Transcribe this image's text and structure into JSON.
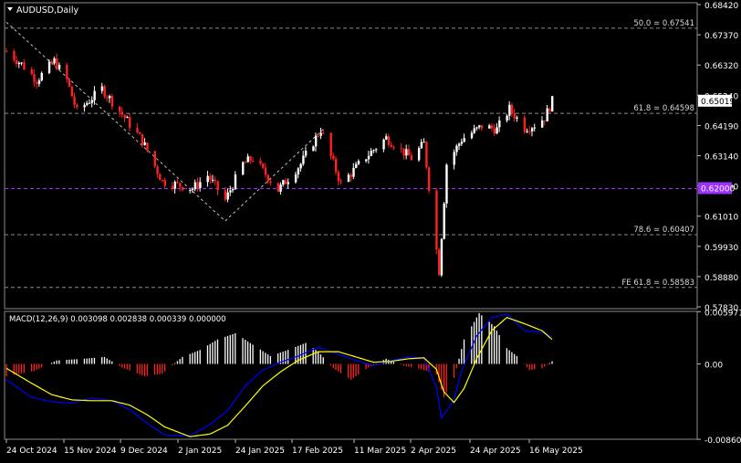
{
  "symbol_label": "AUDUSD,Daily",
  "macd_label": "MACD(12,26,9) 0.003098 0.002838 0.000339 0.000000",
  "colors": {
    "background": "#000000",
    "bull_candle": "#ffffff",
    "bear_candle": "#ff2020",
    "grid_dash": "#8a8a8a",
    "support_line": "#9b30ff",
    "price_tag_bg": "#ffffff",
    "support_tag_bg": "#9b30ff",
    "macd_line": "#0000ff",
    "signal_line": "#ffff00",
    "trendline": "#c0c0c0"
  },
  "chart_data": [
    {
      "type": "candlestick",
      "panel": "price",
      "title": "AUDUSD,Daily",
      "ylim": [
        0.5785,
        0.6842
      ],
      "y_ticks": [
        "0.68420",
        "0.67370",
        "0.66320",
        "0.65240",
        "0.64190",
        "0.63140",
        "0.62090",
        "0.61010",
        "0.59930",
        "0.58880",
        "0.57830"
      ],
      "x_ticks": [
        "24 Oct 2024",
        "15 Nov 2024",
        "9 Dec 2024",
        "2 Jan 2025",
        "24 Jan 2025",
        "17 Feb 2025",
        "11 Mar 2025",
        "2 Apr 2025",
        "24 Apr 2025",
        "16 May 2025"
      ],
      "current_price": "0.65019",
      "support_tag": "0.62000",
      "levels": [
        {
          "label": "50.0 = 0.67541",
          "value": 0.67541,
          "style": "dashed"
        },
        {
          "label": "61.8 = 0.64598",
          "value": 0.64598,
          "style": "dashed"
        },
        {
          "label": "",
          "value": 0.62,
          "style": "support"
        },
        {
          "label": "78.6 = 0.60407",
          "value": 0.60407,
          "style": "dashed"
        },
        {
          "label": "FE 61.8 = 0.58583",
          "value": 0.58583,
          "style": "dashed"
        }
      ],
      "trendlines": [
        {
          "from": {
            "date": "2024-10-18",
            "price": 0.6775
          },
          "to": {
            "date": "2025-01-13",
            "price": 0.6088
          }
        },
        {
          "from": {
            "date": "2025-01-13",
            "price": 0.6088
          },
          "to": {
            "date": "2025-02-21",
            "price": 0.6405
          }
        }
      ],
      "segments": [
        {
          "date": "2024-10-18",
          "price": 0.6675
        },
        {
          "date": "2024-10-24",
          "price": 0.663
        },
        {
          "date": "2024-10-30",
          "price": 0.6575
        },
        {
          "date": "2024-11-06",
          "price": 0.664
        },
        {
          "date": "2024-11-11",
          "price": 0.6575
        },
        {
          "date": "2024-11-15",
          "price": 0.6465
        },
        {
          "date": "2024-11-25",
          "price": 0.6545
        },
        {
          "date": "2024-12-04",
          "price": 0.6445
        },
        {
          "date": "2024-12-11",
          "price": 0.6365
        },
        {
          "date": "2024-12-19",
          "price": 0.6225
        },
        {
          "date": "2024-12-31",
          "price": 0.62
        },
        {
          "date": "2025-01-06",
          "price": 0.6245
        },
        {
          "date": "2025-01-13",
          "price": 0.616
        },
        {
          "date": "2025-01-20",
          "price": 0.6285
        },
        {
          "date": "2025-01-24",
          "price": 0.6305
        },
        {
          "date": "2025-02-03",
          "price": 0.6195
        },
        {
          "date": "2025-02-12",
          "price": 0.6285
        },
        {
          "date": "2025-02-20",
          "price": 0.6405
        },
        {
          "date": "2025-02-28",
          "price": 0.6215
        },
        {
          "date": "2025-03-10",
          "price": 0.631
        },
        {
          "date": "2025-03-18",
          "price": 0.6375
        },
        {
          "date": "2025-03-28",
          "price": 0.6305
        },
        {
          "date": "2025-04-02",
          "price": 0.6355
        },
        {
          "date": "2025-04-08",
          "price": 0.5915
        },
        {
          "date": "2025-04-11",
          "price": 0.6285
        },
        {
          "date": "2025-04-17",
          "price": 0.637
        },
        {
          "date": "2025-04-25",
          "price": 0.6415
        },
        {
          "date": "2025-05-01",
          "price": 0.6405
        },
        {
          "date": "2025-05-06",
          "price": 0.6475
        },
        {
          "date": "2025-05-12",
          "price": 0.641
        },
        {
          "date": "2025-05-16",
          "price": 0.642
        },
        {
          "date": "2025-05-20",
          "price": 0.6445
        },
        {
          "date": "2025-05-23",
          "price": 0.6502
        }
      ]
    },
    {
      "type": "macd",
      "panel": "indicator",
      "title": "MACD(12,26,9) 0.003098 0.002838 0.000339 0.000000",
      "ylim": [
        -0.0086,
        0.006
      ],
      "y_ticks": [
        "0.005971",
        "0.00",
        "-0.008607"
      ],
      "histogram": [
        {
          "date": "2024-10-18",
          "value": -0.0014
        },
        {
          "date": "2024-10-29",
          "value": -0.0008
        },
        {
          "date": "2024-11-07",
          "value": 0.0004
        },
        {
          "date": "2024-11-18",
          "value": 0.0006
        },
        {
          "date": "2024-11-26",
          "value": 0.0008
        },
        {
          "date": "2024-12-03",
          "value": -0.0004
        },
        {
          "date": "2024-12-12",
          "value": -0.0014
        },
        {
          "date": "2024-12-19",
          "value": -0.0011
        },
        {
          "date": "2024-12-27",
          "value": 0.0008
        },
        {
          "date": "2025-01-03",
          "value": 0.0016
        },
        {
          "date": "2025-01-10",
          "value": 0.0028
        },
        {
          "date": "2025-01-17",
          "value": 0.0035
        },
        {
          "date": "2025-01-24",
          "value": 0.0022
        },
        {
          "date": "2025-01-31",
          "value": 0.0009
        },
        {
          "date": "2025-02-07",
          "value": 0.0016
        },
        {
          "date": "2025-02-14",
          "value": 0.0024
        },
        {
          "date": "2025-02-19",
          "value": 0.0014
        },
        {
          "date": "2025-02-25",
          "value": -0.0005
        },
        {
          "date": "2025-03-04",
          "value": -0.0018
        },
        {
          "date": "2025-03-11",
          "value": -0.0004
        },
        {
          "date": "2025-03-18",
          "value": 0.0006
        },
        {
          "date": "2025-03-25",
          "value": -0.0002
        },
        {
          "date": "2025-04-01",
          "value": -0.0006
        },
        {
          "date": "2025-04-07",
          "value": -0.0012
        },
        {
          "date": "2025-04-10",
          "value": -0.0038
        },
        {
          "date": "2025-04-14",
          "value": -0.0016
        },
        {
          "date": "2025-04-18",
          "value": 0.0028
        },
        {
          "date": "2025-04-24",
          "value": 0.0058
        },
        {
          "date": "2025-04-30",
          "value": 0.0043
        },
        {
          "date": "2025-05-05",
          "value": 0.0018
        },
        {
          "date": "2025-05-09",
          "value": 0.0009
        },
        {
          "date": "2025-05-14",
          "value": -0.0007
        },
        {
          "date": "2025-05-19",
          "value": -0.0005
        },
        {
          "date": "2025-05-23",
          "value": 0.0003
        }
      ],
      "macd": [
        {
          "date": "2024-10-18",
          "value": -0.0018
        },
        {
          "date": "2024-10-28",
          "value": -0.0038
        },
        {
          "date": "2024-11-05",
          "value": -0.0043
        },
        {
          "date": "2024-11-13",
          "value": -0.0045
        },
        {
          "date": "2024-11-21",
          "value": -0.0039
        },
        {
          "date": "2024-11-29",
          "value": -0.0042
        },
        {
          "date": "2024-12-06",
          "value": -0.0052
        },
        {
          "date": "2024-12-13",
          "value": -0.0068
        },
        {
          "date": "2024-12-20",
          "value": -0.0081
        },
        {
          "date": "2024-12-30",
          "value": -0.0082
        },
        {
          "date": "2025-01-07",
          "value": -0.0069
        },
        {
          "date": "2025-01-14",
          "value": -0.0053
        },
        {
          "date": "2025-01-21",
          "value": -0.0025
        },
        {
          "date": "2025-01-28",
          "value": -0.0007
        },
        {
          "date": "2025-02-04",
          "value": 0.0002
        },
        {
          "date": "2025-02-11",
          "value": 0.0009
        },
        {
          "date": "2025-02-19",
          "value": 0.0019
        },
        {
          "date": "2025-02-27",
          "value": 0.0011
        },
        {
          "date": "2025-03-06",
          "value": 0.0004
        },
        {
          "date": "2025-03-13",
          "value": -0.0002
        },
        {
          "date": "2025-03-20",
          "value": 0.0004
        },
        {
          "date": "2025-03-27",
          "value": 0.0008
        },
        {
          "date": "2025-04-02",
          "value": 0.0007
        },
        {
          "date": "2025-04-07",
          "value": -0.0026
        },
        {
          "date": "2025-04-09",
          "value": -0.0062
        },
        {
          "date": "2025-04-14",
          "value": -0.0041
        },
        {
          "date": "2025-04-17",
          "value": -0.0008
        },
        {
          "date": "2025-04-23",
          "value": 0.0032
        },
        {
          "date": "2025-04-29",
          "value": 0.0053
        },
        {
          "date": "2025-05-05",
          "value": 0.0057
        },
        {
          "date": "2025-05-12",
          "value": 0.0038
        },
        {
          "date": "2025-05-19",
          "value": 0.0036
        },
        {
          "date": "2025-05-23",
          "value": 0.0031
        }
      ],
      "signal": [
        {
          "date": "2024-10-18",
          "value": -0.0005
        },
        {
          "date": "2024-10-28",
          "value": -0.0022
        },
        {
          "date": "2024-11-05",
          "value": -0.0035
        },
        {
          "date": "2024-11-13",
          "value": -0.0041
        },
        {
          "date": "2024-11-21",
          "value": -0.0042
        },
        {
          "date": "2024-11-29",
          "value": -0.0042
        },
        {
          "date": "2024-12-06",
          "value": -0.0047
        },
        {
          "date": "2024-12-13",
          "value": -0.0058
        },
        {
          "date": "2024-12-20",
          "value": -0.0072
        },
        {
          "date": "2024-12-30",
          "value": -0.0083
        },
        {
          "date": "2025-01-07",
          "value": -0.008
        },
        {
          "date": "2025-01-14",
          "value": -0.007
        },
        {
          "date": "2025-01-21",
          "value": -0.0048
        },
        {
          "date": "2025-01-28",
          "value": -0.0025
        },
        {
          "date": "2025-02-04",
          "value": -0.0009
        },
        {
          "date": "2025-02-11",
          "value": 0.0004
        },
        {
          "date": "2025-02-19",
          "value": 0.0014
        },
        {
          "date": "2025-02-27",
          "value": 0.0014
        },
        {
          "date": "2025-03-06",
          "value": 0.0008
        },
        {
          "date": "2025-03-13",
          "value": 0.0002
        },
        {
          "date": "2025-03-20",
          "value": 0.0003
        },
        {
          "date": "2025-03-27",
          "value": 0.0006
        },
        {
          "date": "2025-04-02",
          "value": 0.0007
        },
        {
          "date": "2025-04-07",
          "value": -0.0006
        },
        {
          "date": "2025-04-10",
          "value": -0.0032
        },
        {
          "date": "2025-04-14",
          "value": -0.0044
        },
        {
          "date": "2025-04-18",
          "value": -0.0028
        },
        {
          "date": "2025-04-23",
          "value": 0.0006
        },
        {
          "date": "2025-04-29",
          "value": 0.0038
        },
        {
          "date": "2025-05-05",
          "value": 0.0053
        },
        {
          "date": "2025-05-12",
          "value": 0.0046
        },
        {
          "date": "2025-05-19",
          "value": 0.0038
        },
        {
          "date": "2025-05-23",
          "value": 0.0028
        }
      ]
    }
  ]
}
